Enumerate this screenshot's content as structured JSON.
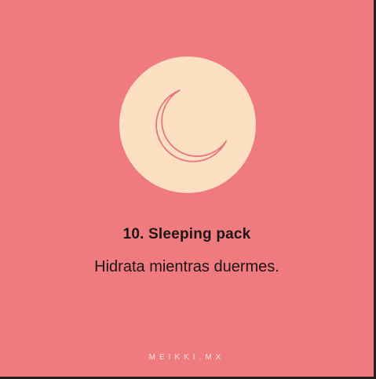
{
  "card": {
    "background_color": "#f07b7f",
    "badge_color": "#fde0c2",
    "icon": "crescent-moon-icon",
    "title": "10. Sleeping pack",
    "subtitle": "Hidrata mientras duermes.",
    "brand": "MEIKKI.MX"
  }
}
